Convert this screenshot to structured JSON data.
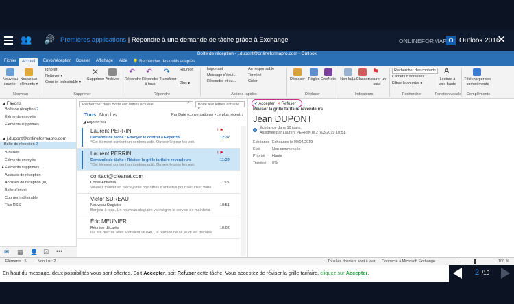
{
  "course": {
    "section": "Premières applications",
    "separator": " | ",
    "lesson": "Répondre à une demande de tâche grâce à Exchange",
    "brand": "ONLINEFORMAPRO",
    "product": "Outlook 2016",
    "ol_logo": "O"
  },
  "window": {
    "title": "Boîte de réception - j.dupont@onlineformapro.com - Outlook"
  },
  "tabs": [
    "Fichier",
    "Accueil",
    "Envoi/réception",
    "Dossier",
    "Affichage",
    "Aide"
  ],
  "tellme": "Rechercher des outils adaptés",
  "ribbon": {
    "nouveau_courrier": "Nouveau courrier",
    "nouveaux_elements": "Nouveaux éléments ▾",
    "ignorer": "Ignorer",
    "nettoyer": "Nettoyer ▾",
    "courrier_indesirable": "Courrier indésirable ▾",
    "supprimer": "Supprimer",
    "archiver": "Archiver",
    "repondre": "Répondre",
    "repondre_tous": "Répondre à tous",
    "transferer": "Transférer",
    "reunion": "Réunion",
    "plus": "Plus ▾",
    "important": "Important",
    "message_equipe": "Message d'équi...",
    "repondre_supprimer": "Répondre et su...",
    "au_responsable": "Au responsable",
    "termine": "Terminé",
    "creer": "Créer",
    "deplacer": "Déplacer",
    "regles": "Règles",
    "onenote": "OneNote",
    "non_lu": "Non lu/Lu",
    "classer": "Classer",
    "assurer_suivi": "Assurer un suivi",
    "rechercher_contacts": "Rechercher des contacts",
    "carnet": "Carnets d'adresses",
    "filtrer": "Filtrer le courrier ▾",
    "lecture_voix": "Lecture à voix haute",
    "telecharger": "Télécharger des compléments",
    "groups": [
      "Nouveau",
      "Supprimer",
      "Répondre",
      "Actions rapides",
      "Déplacer",
      "Indicateurs",
      "Rechercher",
      "Fonction vocale",
      "Compléments"
    ]
  },
  "folders": {
    "favoris": "◢ Favoris",
    "fav_items": [
      {
        "label": "Boîte de réception",
        "count": "2"
      },
      {
        "label": "Éléments envoyés",
        "count": ""
      },
      {
        "label": "Éléments supprimés",
        "count": ""
      }
    ],
    "account": "◢ j.dupont@onlineformapro.com",
    "items": [
      {
        "label": "Boîte de réception",
        "count": "2"
      },
      {
        "label": "Brouillon",
        "count": ""
      },
      {
        "label": "Éléments envoyés",
        "count": ""
      },
      {
        "label": "▸ Éléments supprimés",
        "count": ""
      },
      {
        "label": "Accusés de réception",
        "count": ""
      },
      {
        "label": "Accusés de réception (lu)",
        "count": ""
      },
      {
        "label": "Boîte d'envoi",
        "count": ""
      },
      {
        "label": "Courrier indésirable",
        "count": ""
      },
      {
        "label": "Flux RSS",
        "count": ""
      }
    ]
  },
  "list": {
    "search_placeholder": "Rechercher dans Boîte aux lettres actuelle",
    "scope": "Boîte aux lettres actuelle ▾",
    "tab_all": "Tous",
    "tab_unread": "Non lus",
    "sort": "Par Date (conversations) ▾",
    "order": "Le plus récent ↓",
    "group": "◢ Aujourd'hui",
    "messages": [
      {
        "name": "Laurent PERRIN",
        "subject": "Demande de tâche : Envoyer le contrat à Expert59",
        "preview": "*Cet élément contient un contenu actif. Ouvrez-le pour les voir.",
        "time": "12:37",
        "flags": "! ⚑",
        "unread": true,
        "selected": false
      },
      {
        "name": "Laurent PERRIN",
        "subject": "Demande de tâche : Réviser la grille tarifaire revendeurs",
        "preview": "*Cet élément contient un contenu actif. Ouvrez-le pour les voir.",
        "time": "11:29",
        "flags": "! ⚑",
        "unread": true,
        "selected": true
      },
      {
        "name": "contact@cleanet.com",
        "subject": "Offres Antivirus",
        "preview": "Veuillez trouver en pièce jointe nos offres d'antivirus pour sécuriser votre",
        "time": "11:15",
        "flags": "",
        "unread": false,
        "selected": false
      },
      {
        "name": "Victor SUREAU",
        "subject": "Nouveau Stagiaire",
        "preview": "Bonjour à tous, Un nouveau stagiaire va intégrer le service de maintena",
        "time": "10:51",
        "flags": "",
        "unread": false,
        "selected": false
      },
      {
        "name": "Éric MEUNIER",
        "subject": "Réunion décalée",
        "preview": "Il a été discuté avec Monsieur DUVAL, la réunion de ce jeudi est décalée",
        "time": "10:02",
        "flags": "",
        "unread": false,
        "selected": false
      }
    ]
  },
  "reading": {
    "accept": "Accepter",
    "refuse": "Refuser",
    "task_subject": "Réviser la grille tarifaire revendeurs",
    "sender": "Jean DUPONT",
    "info_line1": "Échéance dans 10 jours.",
    "info_line2": "Assignée par Laurent PERRIN le 27/03/2019 10:51.",
    "fields": [
      {
        "label": "Échéance",
        "value": "Échéance le 09/04/2019"
      },
      {
        "label": "État",
        "value": "Non commencée"
      },
      {
        "label": "Priorité",
        "value": "Haute"
      },
      {
        "label": "Terminé",
        "value": "0%"
      }
    ]
  },
  "status": {
    "elements": "Éléments : 5",
    "unread": "Non lus : 2",
    "uptodate": "Tous les dossiers sont à jour.",
    "connected": "Connecté à Microsoft Exchange",
    "zoom": "100 %"
  },
  "caption": {
    "part1": "En haut du message, deux possibilités vous sont offertes. Soit ",
    "accept": "Accepter",
    "part2": ", soit ",
    "refuse": "Refuser",
    "part3": " cette tâche. Vous acceptez de réviser la grille tarifaire, ",
    "click": "cliquez sur",
    "accept2": "Accepter",
    "end": "."
  },
  "pager": {
    "current": "2",
    "total": "/10"
  },
  "colors": {
    "accent": "#2b6fb5",
    "highlight": "#cc2f8a",
    "course_link": "#2f8be6",
    "green": "#23a33a"
  }
}
